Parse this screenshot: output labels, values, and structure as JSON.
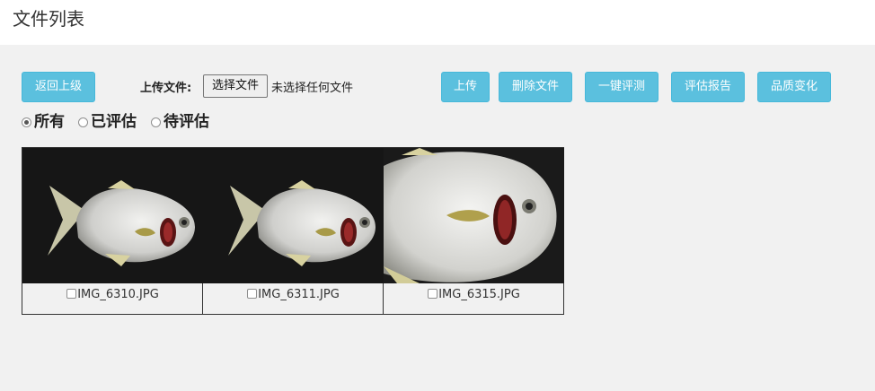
{
  "header": {
    "title": "文件列表"
  },
  "toolbar": {
    "back_label": "返回上级",
    "upload_file_label": "上传文件:",
    "choose_file_label": "选择文件",
    "no_file_text": "未选择任何文件",
    "upload_label": "上传",
    "delete_label": "删除文件",
    "one_click_eval_label": "一键评测",
    "eval_report_label": "评估报告",
    "quality_change_label": "品质变化",
    "accent_color": "#5bc0de"
  },
  "filter": {
    "options": [
      {
        "label": "所有",
        "selected": true
      },
      {
        "label": "已评估",
        "selected": false
      },
      {
        "label": "待评估",
        "selected": false
      }
    ]
  },
  "files": [
    {
      "name": "IMG_6310.JPG",
      "checked": false
    },
    {
      "name": "IMG_6311.JPG",
      "checked": false
    },
    {
      "name": "IMG_6315.JPG",
      "checked": false
    }
  ]
}
